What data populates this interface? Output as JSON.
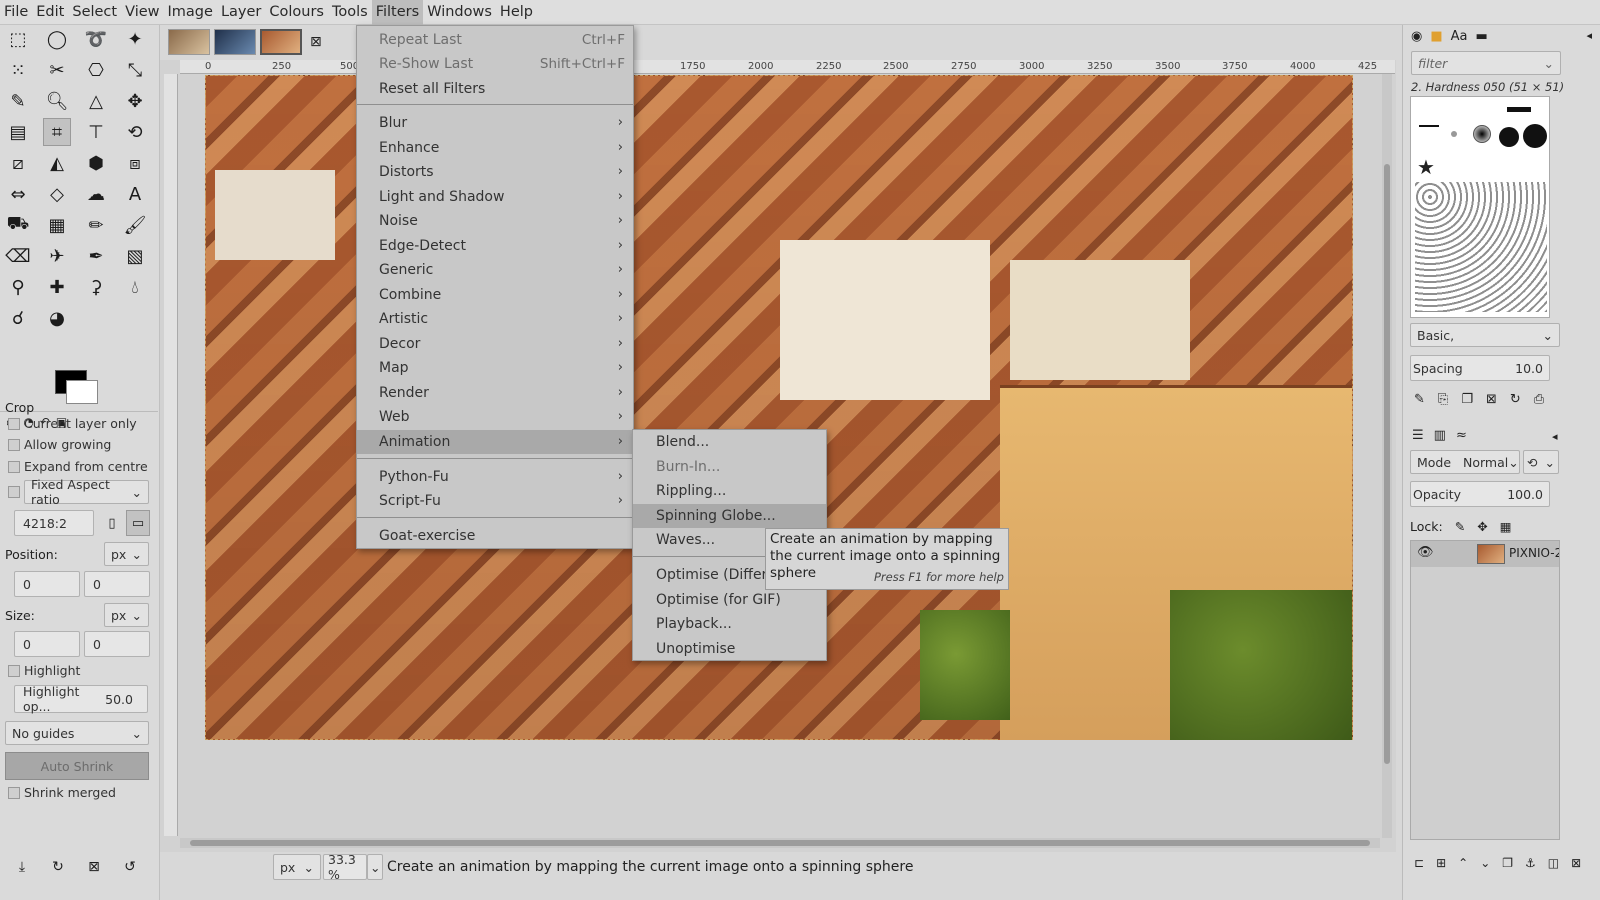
{
  "menubar": [
    "File",
    "Edit",
    "Select",
    "View",
    "Image",
    "Layer",
    "Colours",
    "Tools",
    "Filters",
    "Windows",
    "Help"
  ],
  "tool_options": {
    "title": "Crop",
    "current_layer_only": "Current layer only",
    "allow_growing": "Allow growing",
    "expand_from_centre": "Expand from centre",
    "fixed_label": "Fixed",
    "fixed_value": "Aspect ratio",
    "ratio_value": "4218:2",
    "position_label": "Position:",
    "position_unit": "px",
    "position_x": "0",
    "position_y": "0",
    "size_label": "Size:",
    "size_unit": "px",
    "size_w": "0",
    "size_h": "0",
    "highlight": "Highlight",
    "highlight_opacity_label": "Highlight op...",
    "highlight_opacity_value": "50.0",
    "guides": "No guides",
    "auto_shrink": "Auto Shrink",
    "shrink_merged": "Shrink merged"
  },
  "ruler_ticks": [
    "0",
    "250",
    "500",
    "1750",
    "2000",
    "2250",
    "2500",
    "2750",
    "3000",
    "3250",
    "3500",
    "3750",
    "4000",
    "425"
  ],
  "filters_menu": {
    "repeat_last": "Repeat Last",
    "repeat_last_sc": "Ctrl+F",
    "reshow_last": "Re-Show Last",
    "reshow_last_sc": "Shift+Ctrl+F",
    "reset_all": "Reset all Filters",
    "categories": [
      "Blur",
      "Enhance",
      "Distorts",
      "Light and Shadow",
      "Noise",
      "Edge-Detect",
      "Generic",
      "Combine",
      "Artistic",
      "Decor",
      "Map",
      "Render",
      "Web",
      "Animation"
    ],
    "python_fu": "Python-Fu",
    "script_fu": "Script-Fu",
    "goat": "Goat-exercise"
  },
  "animation_submenu": {
    "blend": "Blend...",
    "burn_in": "Burn-In...",
    "rippling": "Rippling...",
    "spinning_globe": "Spinning Globe...",
    "waves": "Waves...",
    "optimise_diff": "Optimise (Difference)",
    "optimise_gif": "Optimise (for GIF)",
    "playback": "Playback...",
    "unoptimise": "Unoptimise"
  },
  "tooltip": {
    "text": "Create an animation by mapping the current image onto a spinning sphere",
    "help": "Press F1 for more help"
  },
  "statusbar": {
    "unit": "px",
    "zoom": "33.3 %",
    "message": "Create an animation by mapping the current image onto a spinning sphere"
  },
  "right_dock": {
    "filter_placeholder": "filter",
    "brush_name": "2. Hardness 050 (51 × 51)",
    "preset": "Basic,",
    "spacing_label": "Spacing",
    "spacing_value": "10.0",
    "mode_label": "Mode",
    "mode_value": "Normal",
    "opacity_label": "Opacity",
    "opacity_value": "100.0",
    "lock_label": "Lock:",
    "layer_name": "PIXNIO-2"
  }
}
